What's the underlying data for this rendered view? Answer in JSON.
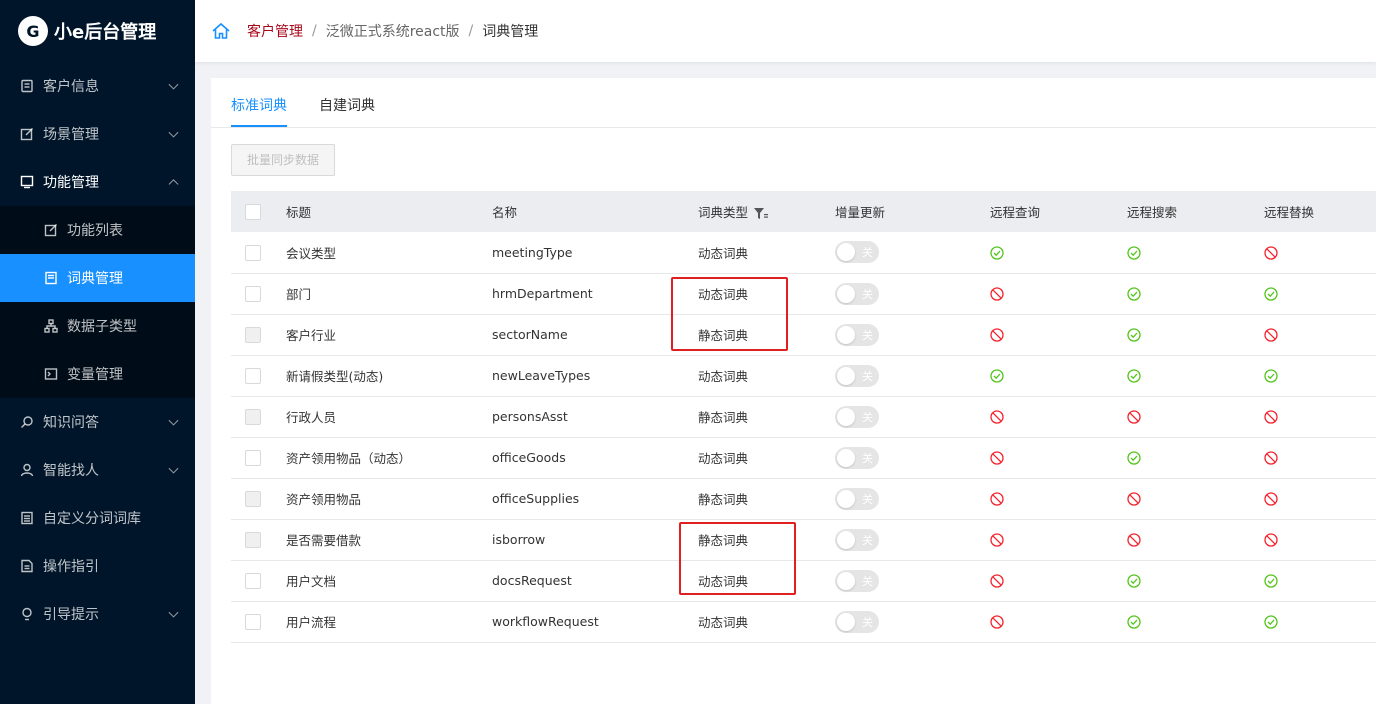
{
  "app": {
    "logo_mark": "G",
    "logo_text": "小e后台管理"
  },
  "sidebar": {
    "items": [
      {
        "label": "客户信息",
        "icon": "file-icon",
        "chevron": "down"
      },
      {
        "label": "场景管理",
        "icon": "edit-icon",
        "chevron": "down"
      },
      {
        "label": "功能管理",
        "icon": "monitor-icon",
        "chevron": "up",
        "open": true
      },
      {
        "label": "知识问答",
        "icon": "search-icon",
        "chevron": "down"
      },
      {
        "label": "智能找人",
        "icon": "user-icon",
        "chevron": "down"
      },
      {
        "label": "自定义分词词库",
        "icon": "list-icon",
        "chevron": ""
      },
      {
        "label": "操作指引",
        "icon": "doc-icon",
        "chevron": ""
      },
      {
        "label": "引导提示",
        "icon": "bulb-icon",
        "chevron": "down"
      }
    ],
    "submenu": [
      {
        "label": "功能列表",
        "icon": "edit-icon"
      },
      {
        "label": "词典管理",
        "icon": "book-icon",
        "active": true
      },
      {
        "label": "数据子类型",
        "icon": "tree-icon"
      },
      {
        "label": "变量管理",
        "icon": "terminal-icon"
      }
    ]
  },
  "breadcrumb": [
    "客户管理",
    "泛微正式系统react版",
    "词典管理"
  ],
  "tabs": [
    {
      "label": "标准词典",
      "active": true
    },
    {
      "label": "自建词典",
      "active": false
    }
  ],
  "toolbar": {
    "sync_button": "批量同步数据"
  },
  "table": {
    "headers": [
      "标题",
      "名称",
      "词典类型",
      "增量更新",
      "远程查询",
      "远程搜索",
      "远程替换"
    ],
    "toggle_label": "关",
    "rows": [
      {
        "title": "会议类型",
        "name": "meetingType",
        "type": "动态词典",
        "cb_disabled": false,
        "q": "ok",
        "s": "ok",
        "r": "no"
      },
      {
        "title": "部门",
        "name": "hrmDepartment",
        "type": "动态词典",
        "cb_disabled": false,
        "q": "no",
        "s": "ok",
        "r": "ok"
      },
      {
        "title": "客户行业",
        "name": "sectorName",
        "type": "静态词典",
        "cb_disabled": true,
        "q": "no",
        "s": "ok",
        "r": "no"
      },
      {
        "title": "新请假类型(动态)",
        "name": "newLeaveTypes",
        "type": "动态词典",
        "cb_disabled": false,
        "q": "ok",
        "s": "ok",
        "r": "ok"
      },
      {
        "title": "行政人员",
        "name": "personsAsst",
        "type": "静态词典",
        "cb_disabled": true,
        "q": "no",
        "s": "no",
        "r": "no"
      },
      {
        "title": "资产领用物品（动态）",
        "name": "officeGoods",
        "type": "动态词典",
        "cb_disabled": false,
        "q": "no",
        "s": "ok",
        "r": "no"
      },
      {
        "title": "资产领用物品",
        "name": "officeSupplies",
        "type": "静态词典",
        "cb_disabled": true,
        "q": "no",
        "s": "no",
        "r": "no"
      },
      {
        "title": "是否需要借款",
        "name": "isborrow",
        "type": "静态词典",
        "cb_disabled": true,
        "q": "no",
        "s": "no",
        "r": "no"
      },
      {
        "title": "用户文档",
        "name": "docsRequest",
        "type": "动态词典",
        "cb_disabled": false,
        "q": "no",
        "s": "ok",
        "r": "ok"
      },
      {
        "title": "用户流程",
        "name": "workflowRequest",
        "type": "动态词典",
        "cb_disabled": false,
        "q": "no",
        "s": "ok",
        "r": "ok"
      }
    ]
  },
  "colors": {
    "ok": "#52c41a",
    "no": "#f5222d",
    "accent": "#1890ff",
    "sidebar": "#001529",
    "highlight": "#e02020"
  }
}
